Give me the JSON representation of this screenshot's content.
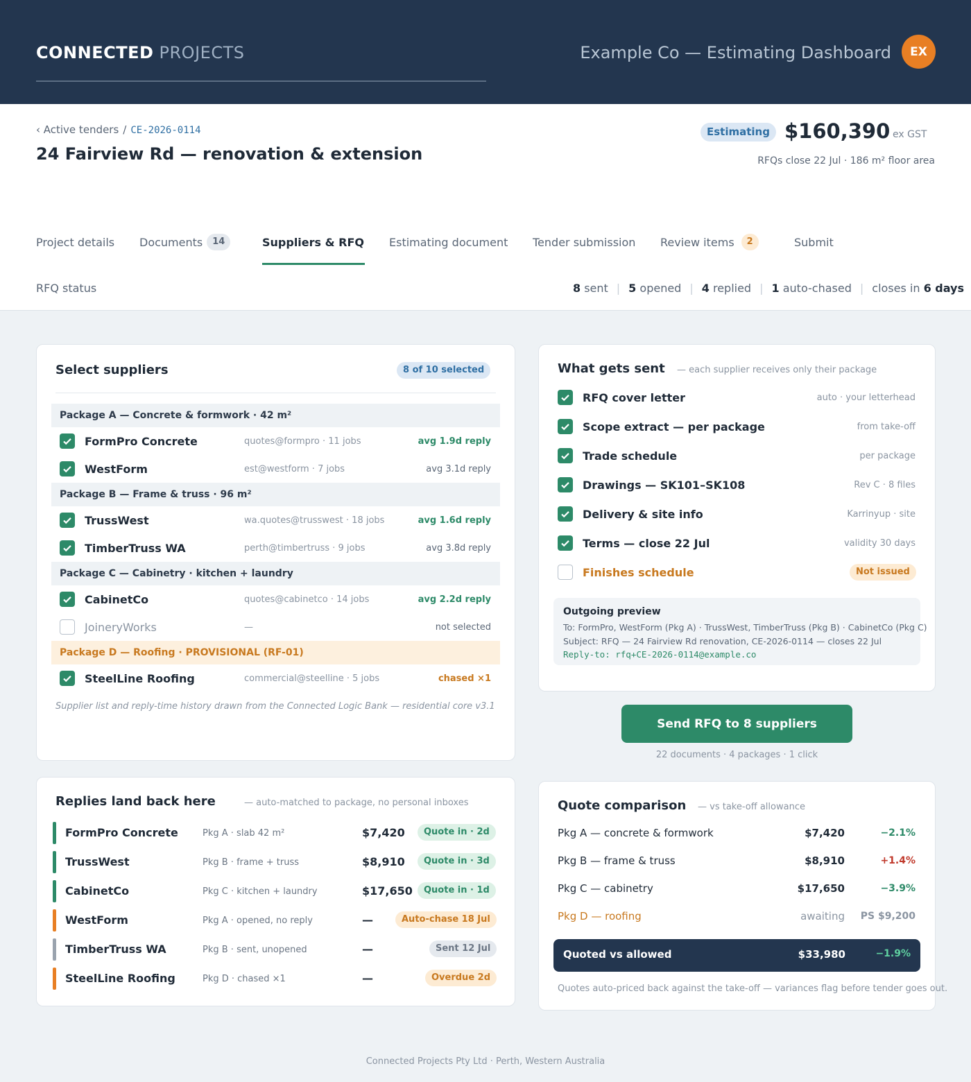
{
  "header": {
    "brand_bold": "CONNECTED",
    "brand_light": "PROJECTS",
    "dashboard_title": "Example Co — Estimating Dashboard",
    "avatar_initials": "EX"
  },
  "project": {
    "breadcrumb_parent": "‹ Active tenders",
    "breadcrumb_sep": "/",
    "code": "CE-2026-0114",
    "title": "24 Fairview Rd — renovation & extension",
    "status": "Estimating",
    "total": "$160,390",
    "total_suffix": "ex GST",
    "closes_info": "RFQs close 22 Jul · 186 m² floor area"
  },
  "tabs": [
    {
      "label": "Project details"
    },
    {
      "label": "Documents",
      "count": "14"
    },
    {
      "label": "Suppliers & RFQ"
    },
    {
      "label": "Estimating document"
    },
    {
      "label": "Tender submission"
    },
    {
      "label": "Review items",
      "count": "2"
    },
    {
      "label": "Submit"
    }
  ],
  "rfq_status": {
    "label": "RFQ status",
    "sent_n": "8",
    "sent": "sent",
    "opened_n": "5",
    "opened": "opened",
    "replied_n": "4",
    "replied": "replied",
    "chased_n": "1",
    "chased": "auto-chased",
    "closes_prefix": "closes in",
    "closes_value": "6 days"
  },
  "select_suppliers": {
    "title": "Select suppliers",
    "selected_badge": "8 of 10 selected",
    "packages": [
      "Package A — Concrete & formwork · 42 m²",
      "Package B — Frame & truss · 96 m²",
      "Package C — Cabinetry · kitchen + laundry",
      "Package D — Roofing · PROVISIONAL (RF-01)"
    ],
    "suppliers": [
      {
        "name": "FormPro Concrete",
        "contact": "quotes@formpro · 11 jobs",
        "reply": "avg 1.9d reply"
      },
      {
        "name": "WestForm",
        "contact": "est@westform · 7 jobs",
        "reply": "avg 3.1d reply"
      },
      {
        "name": "TrussWest",
        "contact": "wa.quotes@trusswest · 18 jobs",
        "reply": "avg 1.6d reply"
      },
      {
        "name": "TimberTruss WA",
        "contact": "perth@timbertruss · 9 jobs",
        "reply": "avg 3.8d reply"
      },
      {
        "name": "CabinetCo",
        "contact": "quotes@cabinetco · 14 jobs",
        "reply": "avg 2.2d reply"
      },
      {
        "name": "JoineryWorks",
        "contact": "—",
        "reply": "not selected"
      },
      {
        "name": "SteelLine Roofing",
        "contact": "commercial@steelline · 5 jobs",
        "reply": "chased ×1"
      }
    ],
    "footnote": "Supplier list and reply-time history drawn from the Connected Logic Bank — residential core v3.1"
  },
  "what_gets_sent": {
    "title": "What gets sent",
    "subtitle": "— each supplier receives only their package",
    "items": [
      {
        "label": "RFQ cover letter",
        "meta": "auto · your letterhead"
      },
      {
        "label": "Scope extract — per package",
        "meta": "from take-off"
      },
      {
        "label": "Trade schedule",
        "meta": "per package"
      },
      {
        "label": "Drawings — SK101–SK108",
        "meta": "Rev C · 8 files"
      },
      {
        "label": "Delivery & site info",
        "meta": "Karrinyup · site"
      },
      {
        "label": "Terms — close 22 Jul",
        "meta": "validity 30 days"
      },
      {
        "label": "Finishes schedule",
        "meta": "Not issued"
      }
    ],
    "preview": {
      "title": "Outgoing preview",
      "to": "To: FormPro, WestForm (Pkg A) · TrussWest, TimberTruss (Pkg B) · CabinetCo (Pkg C)",
      "subject": "Subject: RFQ — 24 Fairview Rd renovation, CE-2026-0114 — closes 22 Jul",
      "reply_to": "Reply-to: rfq+CE-2026-0114@example.co"
    }
  },
  "send": {
    "button": "Send RFQ to 8 suppliers",
    "sub": "22 documents · 4 packages · 1 click"
  },
  "replies": {
    "title": "Replies land back here",
    "subtitle": "— auto-matched to package, no personal inboxes",
    "rows": [
      {
        "name": "FormPro Concrete",
        "meta": "Pkg A · slab 42 m²",
        "amount": "$7,420",
        "status": "Quote in · 2d"
      },
      {
        "name": "TrussWest",
        "meta": "Pkg B · frame + truss",
        "amount": "$8,910",
        "status": "Quote in · 3d"
      },
      {
        "name": "CabinetCo",
        "meta": "Pkg C · kitchen + laundry",
        "amount": "$17,650",
        "status": "Quote in · 1d"
      },
      {
        "name": "WestForm",
        "meta": "Pkg A · opened, no reply",
        "amount": "—",
        "status": "Auto-chase 18 Jul"
      },
      {
        "name": "TimberTruss WA",
        "meta": "Pkg B · sent, unopened",
        "amount": "—",
        "status": "Sent 12 Jul"
      },
      {
        "name": "SteelLine Roofing",
        "meta": "Pkg D · chased ×1",
        "amount": "—",
        "status": "Overdue 2d"
      }
    ]
  },
  "quote_comparison": {
    "title": "Quote comparison",
    "subtitle": "— vs take-off allowance",
    "rows": [
      {
        "label": "Pkg A — concrete & formwork",
        "amount": "$7,420",
        "variance": "−2.1%"
      },
      {
        "label": "Pkg B — frame & truss",
        "amount": "$8,910",
        "variance": "+1.4%"
      },
      {
        "label": "Pkg C — cabinetry",
        "amount": "$17,650",
        "variance": "−3.9%"
      },
      {
        "label": "Pkg D — roofing",
        "amount": "awaiting",
        "variance": "PS $9,200"
      }
    ],
    "total_label": "Quoted vs allowed",
    "total_amount": "$33,980",
    "total_variance": "−1.9%",
    "footnote": "Quotes auto-priced back against the take-off — variances flag before tender goes out."
  },
  "footer": "Connected Projects Pty Ltd · Perth, Western Australia",
  "colors": {
    "navy": "#23364f",
    "accent_green": "#2d8a68",
    "warning_orange": "#c8791f",
    "link_blue": "#2f6fa3",
    "negative_red": "#c0392b"
  }
}
